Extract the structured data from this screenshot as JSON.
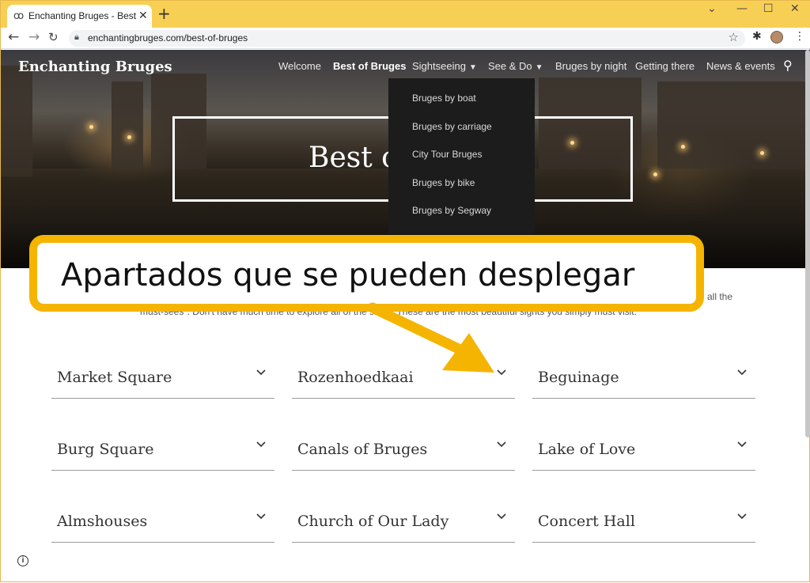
{
  "browser": {
    "tab_title": "Enchanting Bruges - Best of Bruges",
    "url": "enchantingbruges.com/best-of-bruges"
  },
  "site": {
    "brand": "Enchanting Bruges",
    "nav": [
      {
        "label": "Welcome"
      },
      {
        "label": "Best of Bruges",
        "active": true
      },
      {
        "label": "Sightseeing",
        "has_dropdown": true
      },
      {
        "label": "See & Do",
        "has_dropdown": true
      },
      {
        "label": "Bruges by night"
      },
      {
        "label": "Getting there"
      },
      {
        "label": "News & events"
      }
    ],
    "search_icon": "search-icon"
  },
  "dropdown": {
    "items": [
      "Bruges by boat",
      "Bruges by carriage",
      "City Tour Bruges",
      "Bruges by bike",
      "Bruges by Segway"
    ]
  },
  "hero": {
    "title": "Best o"
  },
  "intro": {
    "line_right": "all the",
    "line2": "must-sees\". Don't have much time to explore all of the sites? These are the most beautiful sights you simply must visit."
  },
  "accordion": [
    "Market Square",
    "Rozenhoedkaai",
    "Beguinage",
    "Burg Square",
    "Canals of Bruges",
    "Lake of Love",
    "Almshouses",
    "Church of Our Lady",
    "Concert Hall"
  ],
  "annotation": {
    "text": "Apartados que se pueden desplegar",
    "color": "#f5b400"
  }
}
